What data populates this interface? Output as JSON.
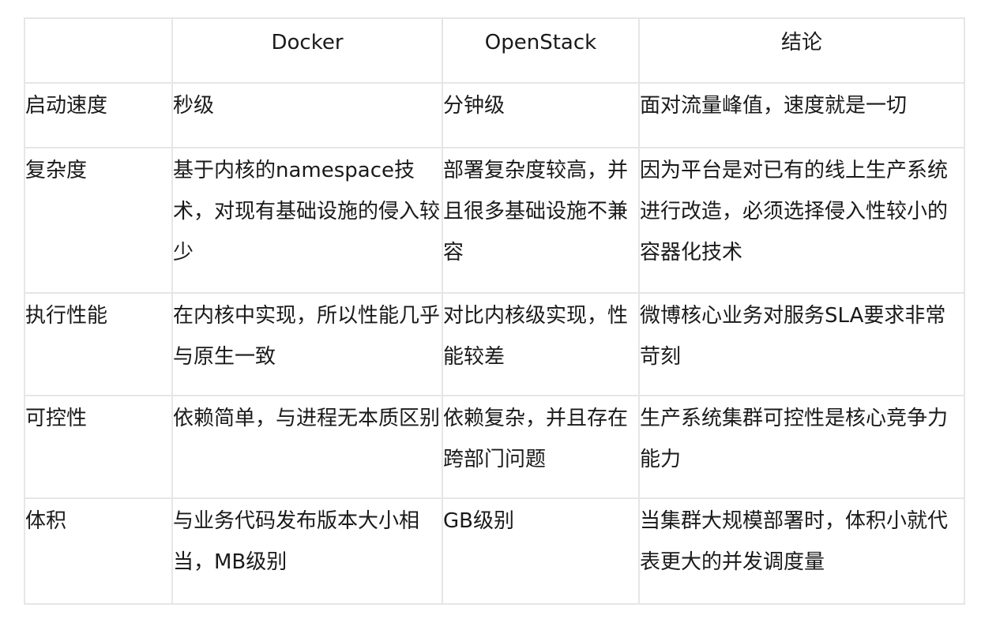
{
  "table": {
    "headers": [
      "",
      "Docker",
      "OpenStack",
      "结论"
    ],
    "rows": [
      [
        "启动速度",
        "秒级",
        "分钟级",
        "面对流量峰值，速度就是一切"
      ],
      [
        "复杂度",
        "基于内核的namespace技术，对现有基础设施的侵入较少",
        "部署复杂度较高，并且很多基础设施不兼容",
        "因为平台是对已有的线上生产系统进行改造，必须选择侵入性较小的容器化技术"
      ],
      [
        "执行性能",
        "在内核中实现，所以性能几乎与原生一致",
        "对比内核级实现，性能较差",
        "微博核心业务对服务SLA要求非常苛刻"
      ],
      [
        "可控性",
        "依赖简单，与进程无本质区别",
        "依赖复杂，并且存在跨部门问题",
        "生产系统集群可控性是核心竞争力能力"
      ],
      [
        "体积",
        "与业务代码发布版本大小相当，MB级别",
        "GB级别",
        "当集群大规模部署时，体积小就代表更大的并发调度量"
      ]
    ]
  }
}
